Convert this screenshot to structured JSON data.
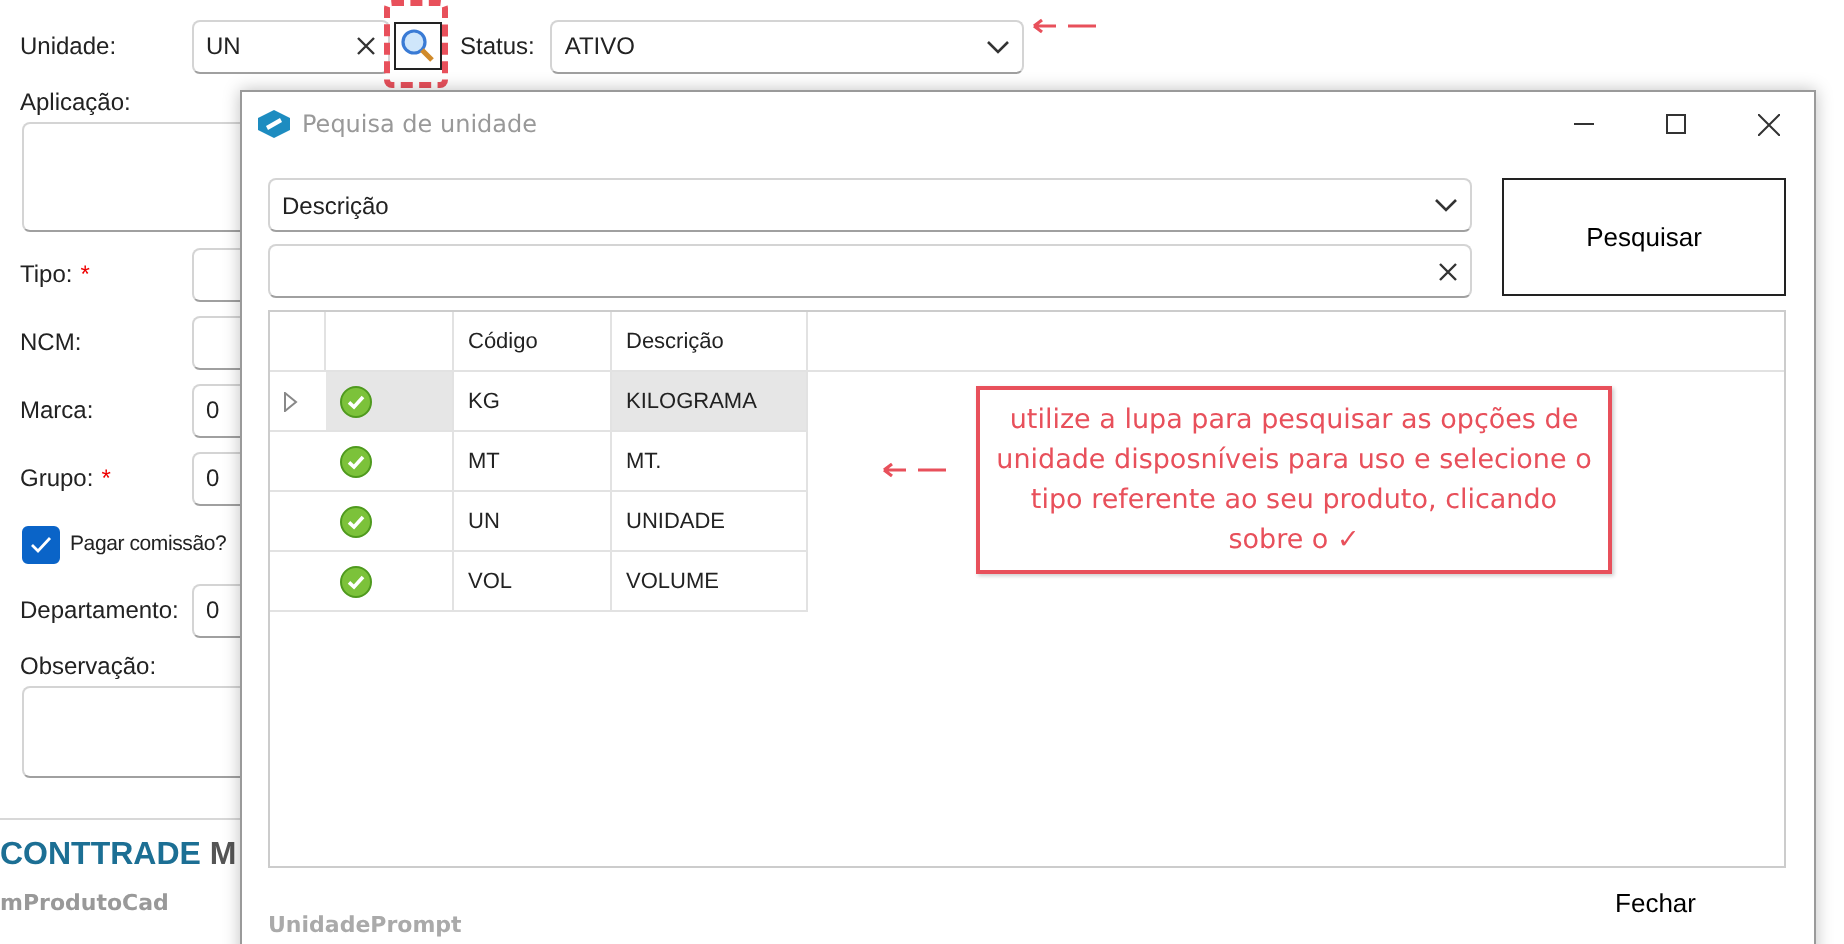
{
  "form": {
    "unit": {
      "label": "Unidade:",
      "value": "UN"
    },
    "status": {
      "label": "Status:",
      "value": "ATIVO"
    },
    "fields": [
      {
        "kind": "textarea",
        "label": "Aplicação:"
      },
      {
        "kind": "text",
        "label": "Tipo:",
        "required_mark": "*"
      },
      {
        "kind": "text",
        "label": "NCM:"
      },
      {
        "kind": "text",
        "label": "Marca:",
        "value": "0"
      },
      {
        "kind": "text",
        "label": "Grupo:",
        "required_mark": "*",
        "value": "0"
      },
      {
        "kind": "checkbox",
        "label": "Pagar comissão?",
        "checked": true
      },
      {
        "kind": "text",
        "label": "Departamento:",
        "value": "0"
      },
      {
        "kind": "textarea",
        "label": "Observação:"
      }
    ]
  },
  "footer": {
    "brand": "CONTTRADE",
    "brand_rest": "M",
    "form_name": "mProdutoCad"
  },
  "dialog": {
    "title": "Pequisa de unidade",
    "search_field": "Descrição",
    "search_button": "Pesquisar",
    "columns": [
      "Código",
      "Descrição"
    ],
    "rows": [
      {
        "code": "KG",
        "description": "KILOGRAMA",
        "selected": true
      },
      {
        "code": "MT",
        "description": "MT.",
        "selected": false
      },
      {
        "code": "UN",
        "description": "UNIDADE",
        "selected": false
      },
      {
        "code": "VOL",
        "description": "VOLUME",
        "selected": false
      }
    ],
    "close_button": "Fechar",
    "name": "UnidadePrompt"
  },
  "annotation": {
    "note": "utilize a lupa para pesquisar as opções de unidade disposníveis para uso e selecione o tipo referente ao seu produto, clicando sobre o ✓"
  }
}
